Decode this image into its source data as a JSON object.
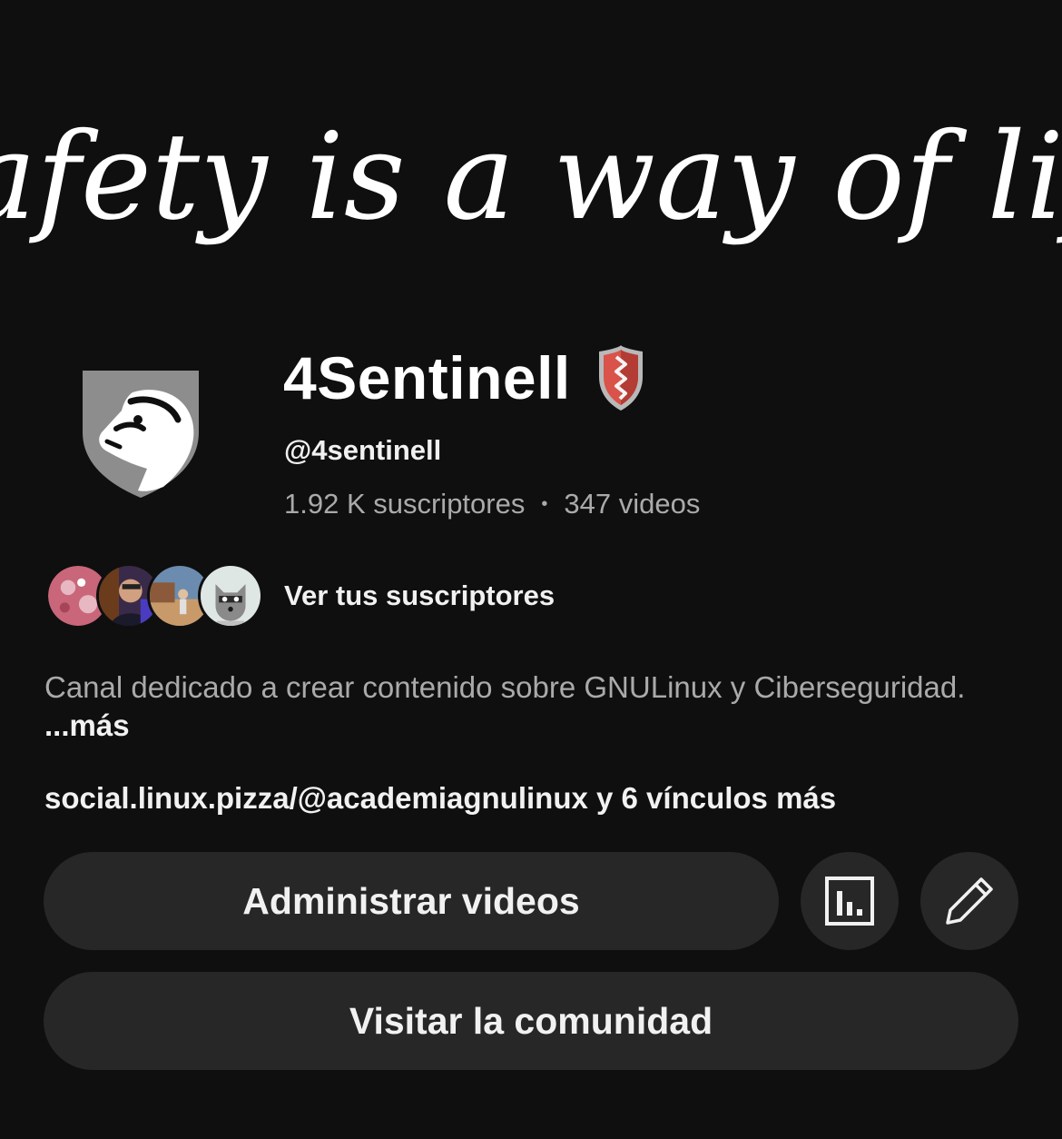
{
  "banner": {
    "tagline": "Safety is a way of life"
  },
  "channel": {
    "name": "4Sentinell",
    "handle": "@4sentinell",
    "subscribers": "1.92 K suscriptores",
    "separator": "•",
    "videos": "347 videos"
  },
  "subscribers_preview": {
    "link_label": "Ver tus suscriptores"
  },
  "description": {
    "text": "Canal dedicado a crear contenido sobre GNULinux y Ciberseguridad.",
    "more_label": "...más"
  },
  "links": {
    "text": "social.linux.pizza/@academiagnulinux y 6 vínculos más"
  },
  "actions": {
    "manage_videos_label": "Administrar videos",
    "analytics_icon": "bar-chart-icon",
    "edit_icon": "pencil-icon",
    "visit_community_label": "Visitar la comunidad"
  },
  "colors": {
    "background": "#0f0f0f",
    "button_bg": "#272727",
    "primary_text": "#f1f1f1",
    "secondary_text": "#aaaaaa",
    "badge_red": "#d9534a"
  }
}
